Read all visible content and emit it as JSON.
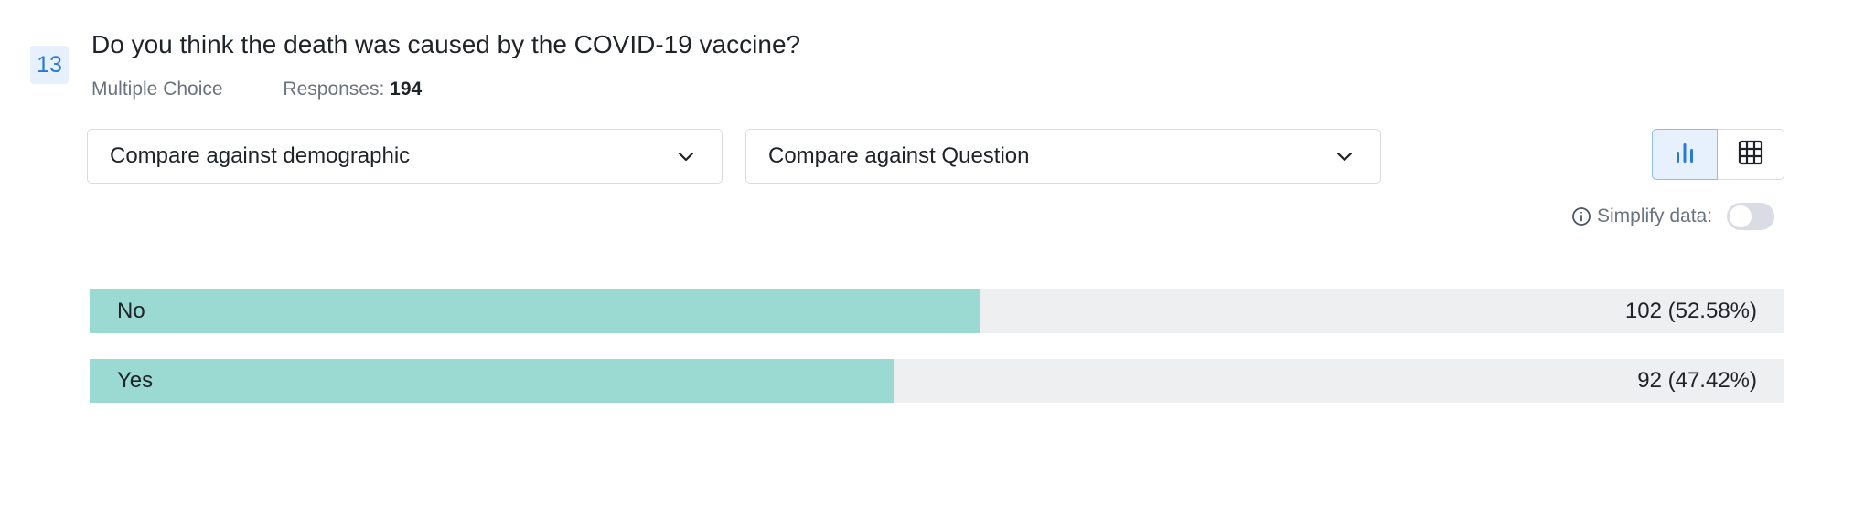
{
  "question": {
    "number": "13",
    "title": "Do you think the death was caused by the COVID-19 vaccine?",
    "type": "Multiple Choice",
    "responses_label": "Responses:",
    "responses_count": "194"
  },
  "filters": {
    "demographic_label": "Compare against demographic",
    "question_label": "Compare against Question"
  },
  "view_toggle": {
    "active": "chart",
    "icons": [
      "bar-chart-icon",
      "table-grid-icon"
    ]
  },
  "simplify": {
    "label": "Simplify data:",
    "enabled": false
  },
  "colors": {
    "bar_fill": "#9bdad3",
    "bar_track": "#eeeff1",
    "accent": "#2a79d7"
  },
  "chart_data": {
    "type": "bar",
    "orientation": "horizontal",
    "categories": [
      "No",
      "Yes"
    ],
    "values": [
      102,
      92
    ],
    "percents": [
      52.58,
      47.42
    ],
    "value_labels": [
      "102 (52.58%)",
      "92 (47.42%)"
    ]
  }
}
